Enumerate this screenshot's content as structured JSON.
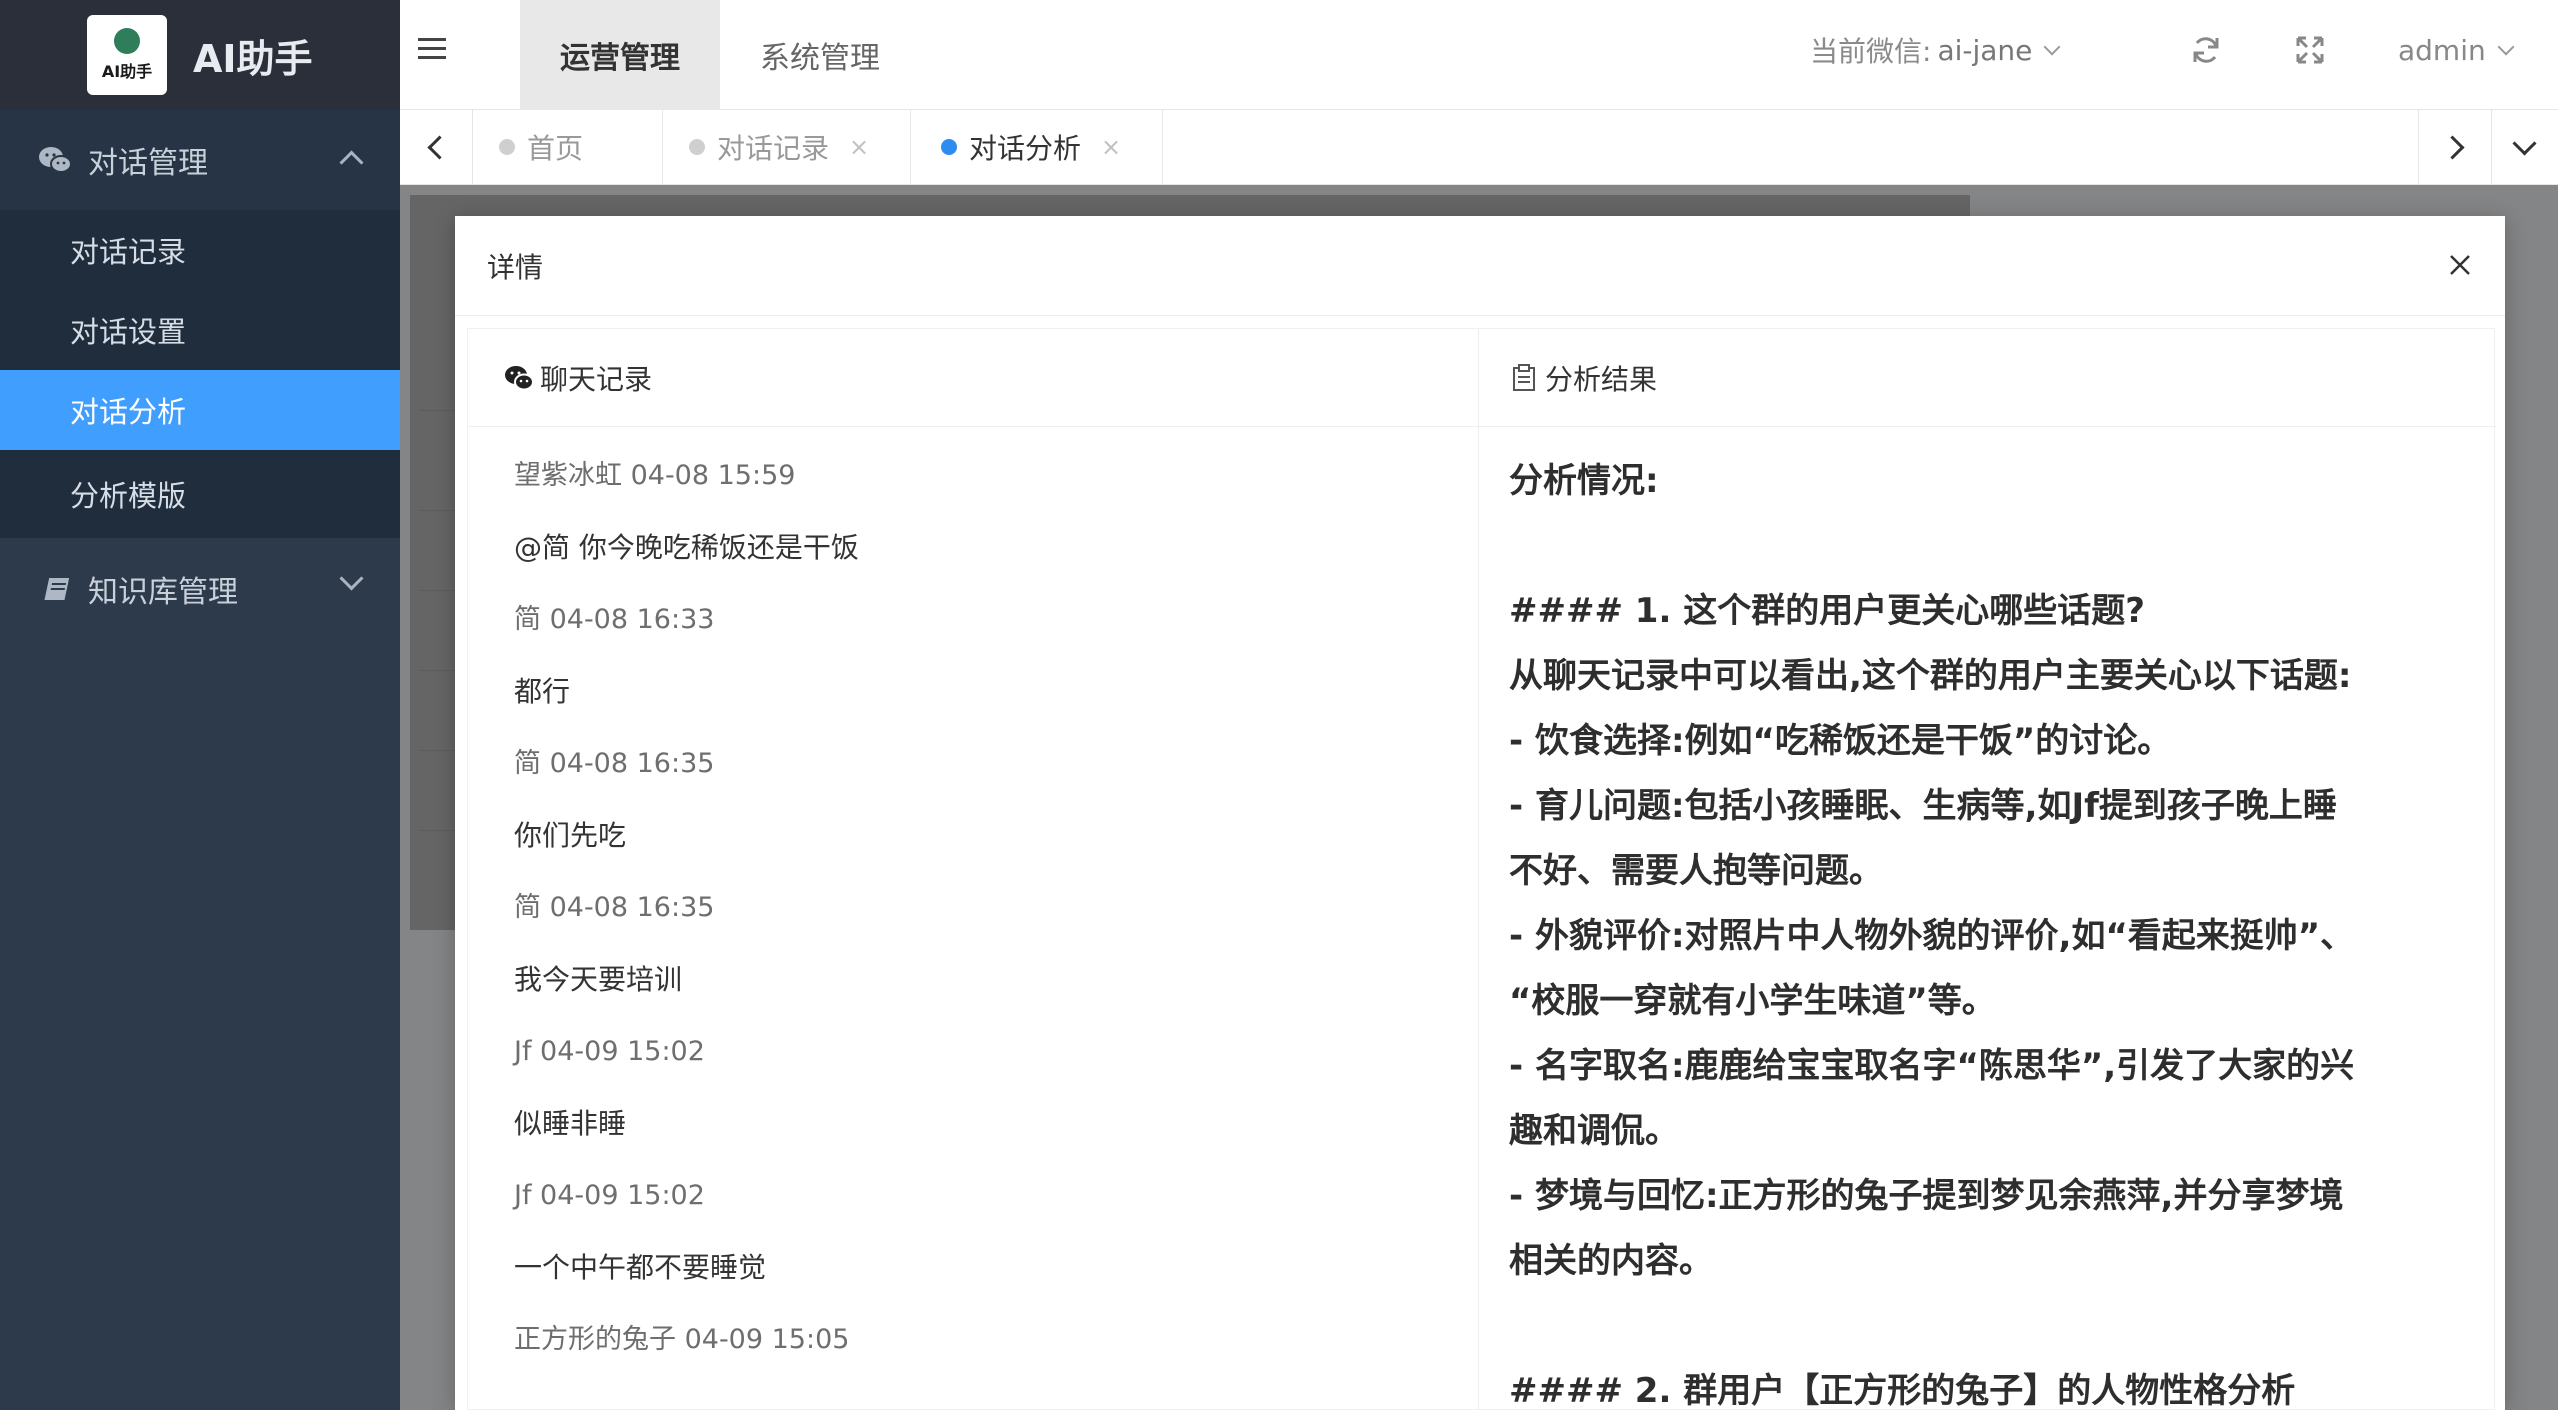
{
  "app": {
    "title": "AI助手",
    "logo_text": "AI助手"
  },
  "sidebar": {
    "groups": [
      {
        "label": "对话管理",
        "icon": "wechat-icon",
        "expanded": true,
        "items": [
          {
            "label": "对话记录",
            "active": false
          },
          {
            "label": "对话设置",
            "active": false
          },
          {
            "label": "对话分析",
            "active": true
          },
          {
            "label": "分析模版",
            "active": false
          }
        ]
      },
      {
        "label": "知识库管理",
        "icon": "book-icon",
        "expanded": false,
        "items": []
      }
    ]
  },
  "header": {
    "top_tabs": [
      {
        "label": "运营管理",
        "active": true
      },
      {
        "label": "系统管理",
        "active": false
      }
    ],
    "wechat_label": "当前微信:",
    "wechat_value": "ai-jane",
    "user": "admin"
  },
  "tabs": [
    {
      "label": "首页",
      "closable": false,
      "active": false
    },
    {
      "label": "对话记录",
      "closable": true,
      "active": false
    },
    {
      "label": "对话分析",
      "closable": true,
      "active": true
    }
  ],
  "modal": {
    "title": "详情",
    "left_header": "聊天记录",
    "right_header": "分析结果",
    "chat": [
      {
        "meta": "望紫冰虹 04-08 15:59",
        "text": "@简  你今晚吃稀饭还是干饭"
      },
      {
        "meta": "简 04-08 16:33",
        "text": "都行"
      },
      {
        "meta": "简 04-08 16:35",
        "text": "你们先吃"
      },
      {
        "meta": "简 04-08 16:35",
        "text": "我今天要培训"
      },
      {
        "meta": "Jf 04-09 15:02",
        "text": "似睡非睡"
      },
      {
        "meta": "Jf 04-09 15:02",
        "text": "一个中午都不要睡觉"
      },
      {
        "meta": "正方形的兔子 04-09 15:05",
        "text": ""
      }
    ],
    "analysis": {
      "heading": "分析情况:",
      "lines": [
        "#### 1. 这个群的用户更关心哪些话题?",
        "从聊天记录中可以看出,这个群的用户主要关心以下话题:",
        "- 饮食选择:例如“吃稀饭还是干饭”的讨论。",
        "- 育儿问题:包括小孩睡眠、生病等,如Jf提到孩子晚上睡",
        "不好、需要人抱等问题。",
        "- 外貌评价:对照片中人物外貌的评价,如“看起来挺帅”、",
        "“校服一穿就有小学生味道”等。",
        "- 名字取名:鹿鹿给宝宝取名字“陈思华”,引发了大家的兴",
        "趣和调侃。",
        "- 梦境与回忆:正方形的兔子提到梦见余燕萍,并分享梦境",
        "相关的内容。"
      ],
      "next_heading": "#### 2. 群用户【正方形的兔子】的人物性格分析"
    }
  },
  "colors": {
    "sidebar_bg": "#2d3a4b",
    "active_item": "#409eff",
    "active_dot": "#2d8cf0"
  }
}
